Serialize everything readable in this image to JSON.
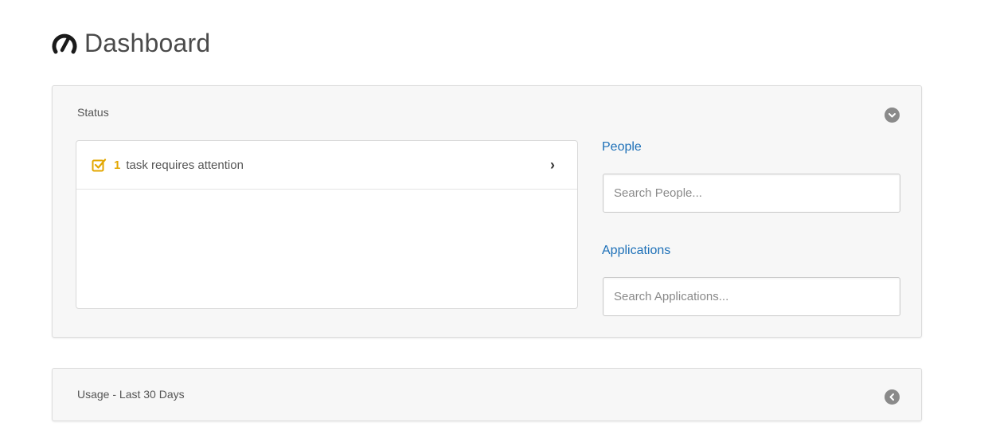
{
  "header": {
    "title": "Dashboard",
    "icon": "speedometer-icon"
  },
  "status_panel": {
    "label": "Status",
    "collapse_icon": "collapse-circle-icon",
    "task": {
      "count": "1",
      "text": "task requires attention",
      "icon": "checkbox-icon",
      "arrow": "›",
      "accent_color": "#e3a700"
    },
    "people": {
      "heading": "People",
      "placeholder": "Search People..."
    },
    "applications": {
      "heading": "Applications",
      "placeholder": "Search Applications..."
    },
    "link_color": "#1d70b8"
  },
  "usage_panel": {
    "label": "Usage - Last 30 Days",
    "collapse_icon": "expand-circle-icon"
  }
}
